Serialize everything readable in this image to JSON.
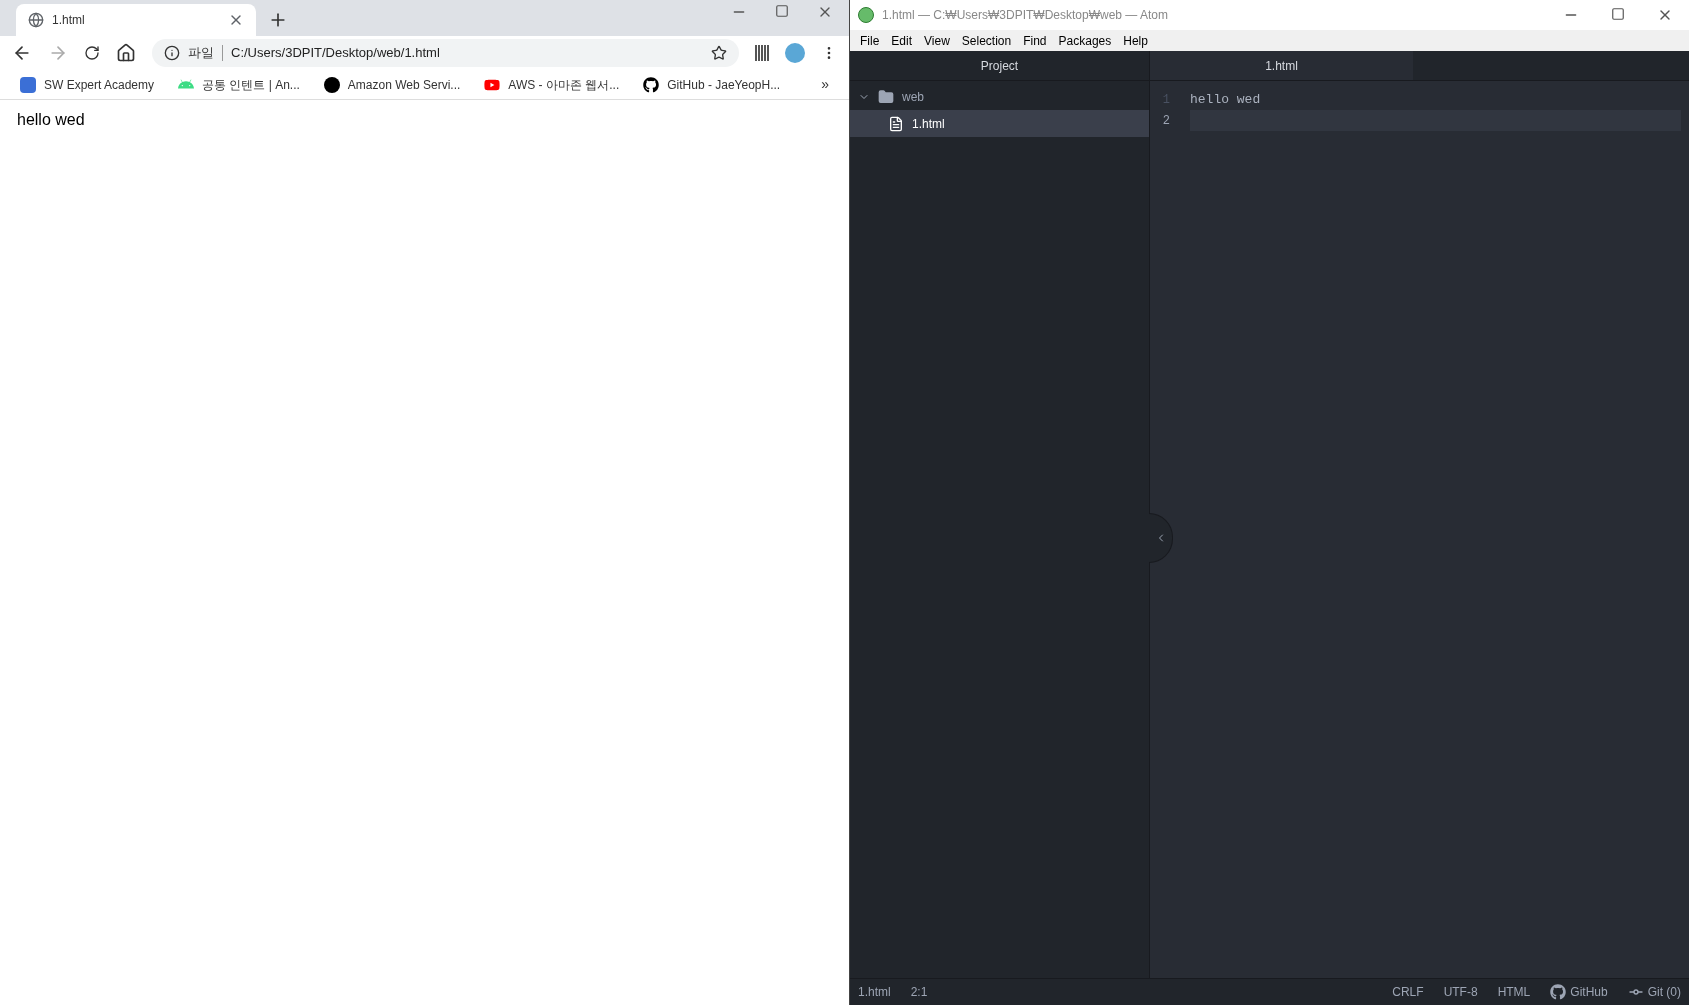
{
  "browser": {
    "tab": {
      "title": "1.html",
      "selected": true
    },
    "address": {
      "scheme_label": "파일",
      "url": "C:/Users/3DPIT/Desktop/web/1.html"
    },
    "bookmarks": [
      {
        "kind": "swea",
        "label": "SW Expert Academy"
      },
      {
        "kind": "android",
        "label": "공통 인텐트  |  An..."
      },
      {
        "kind": "dot",
        "label": "Amazon Web Servi..."
      },
      {
        "kind": "youtube",
        "label": "AWS - 아마존 웹서..."
      },
      {
        "kind": "github",
        "label": "GitHub - JaeYeopH..."
      }
    ],
    "overflow": "»",
    "page_text": "hello wed"
  },
  "editor": {
    "window_title": "1.html — C:₩Users₩3DPIT₩Desktop₩web — Atom",
    "menu": [
      "File",
      "Edit",
      "View",
      "Selection",
      "Find",
      "Packages",
      "Help"
    ],
    "tree": {
      "header": "Project",
      "items": [
        {
          "label": "web",
          "kind": "folder",
          "expanded": true,
          "selected": false,
          "children": [
            {
              "label": "1.html",
              "kind": "file",
              "selected": true
            }
          ]
        }
      ]
    },
    "tabs": [
      {
        "title": "1.html",
        "selected": true
      }
    ],
    "lines": [
      {
        "number": "1",
        "text": "hello wed",
        "current": false
      },
      {
        "number": "2",
        "current": true
      }
    ],
    "status_bar": {
      "left": [
        "1.html",
        "2:1"
      ],
      "right": [
        {
          "kind": "text",
          "label": "CRLF"
        },
        {
          "kind": "text",
          "label": "UTF-8"
        },
        {
          "kind": "text",
          "label": "HTML"
        },
        {
          "kind": "github",
          "label": "GitHub"
        },
        {
          "kind": "git",
          "label": "Git (0)"
        }
      ]
    }
  }
}
